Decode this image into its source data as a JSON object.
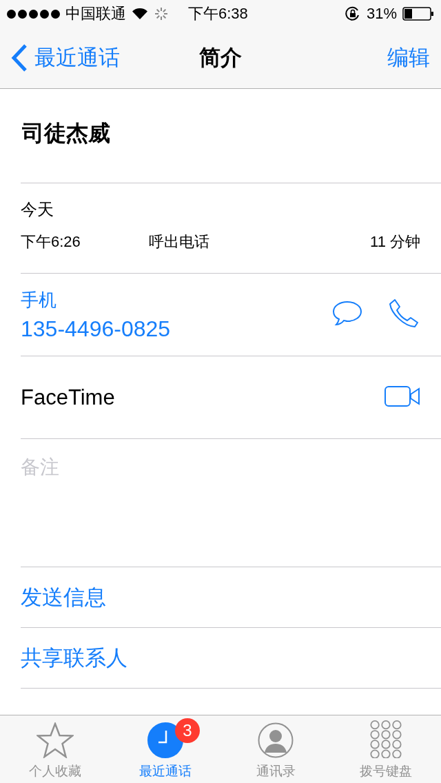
{
  "status_bar": {
    "carrier": "中国联通",
    "time": "下午6:38",
    "battery": "31%"
  },
  "nav": {
    "back": "最近通话",
    "title": "简介",
    "action": "编辑"
  },
  "contact": {
    "name": "司徒杰威"
  },
  "recent": {
    "day": "今天",
    "time": "下午6:26",
    "type": "呼出电话",
    "duration": "11 分钟"
  },
  "phone": {
    "label": "手机",
    "number": "135-4496-0825"
  },
  "facetime": {
    "label": "FaceTime"
  },
  "notes": {
    "placeholder": "备注"
  },
  "actions": [
    "发送信息",
    "共享联系人"
  ],
  "tabs": [
    {
      "kind": "favorites",
      "label": "个人收藏",
      "selected": false
    },
    {
      "kind": "recents",
      "label": "最近通话",
      "selected": true,
      "badge": "3"
    },
    {
      "kind": "contacts",
      "label": "通讯录",
      "selected": false
    },
    {
      "kind": "keypad",
      "label": "拨号键盘",
      "selected": false
    }
  ]
}
